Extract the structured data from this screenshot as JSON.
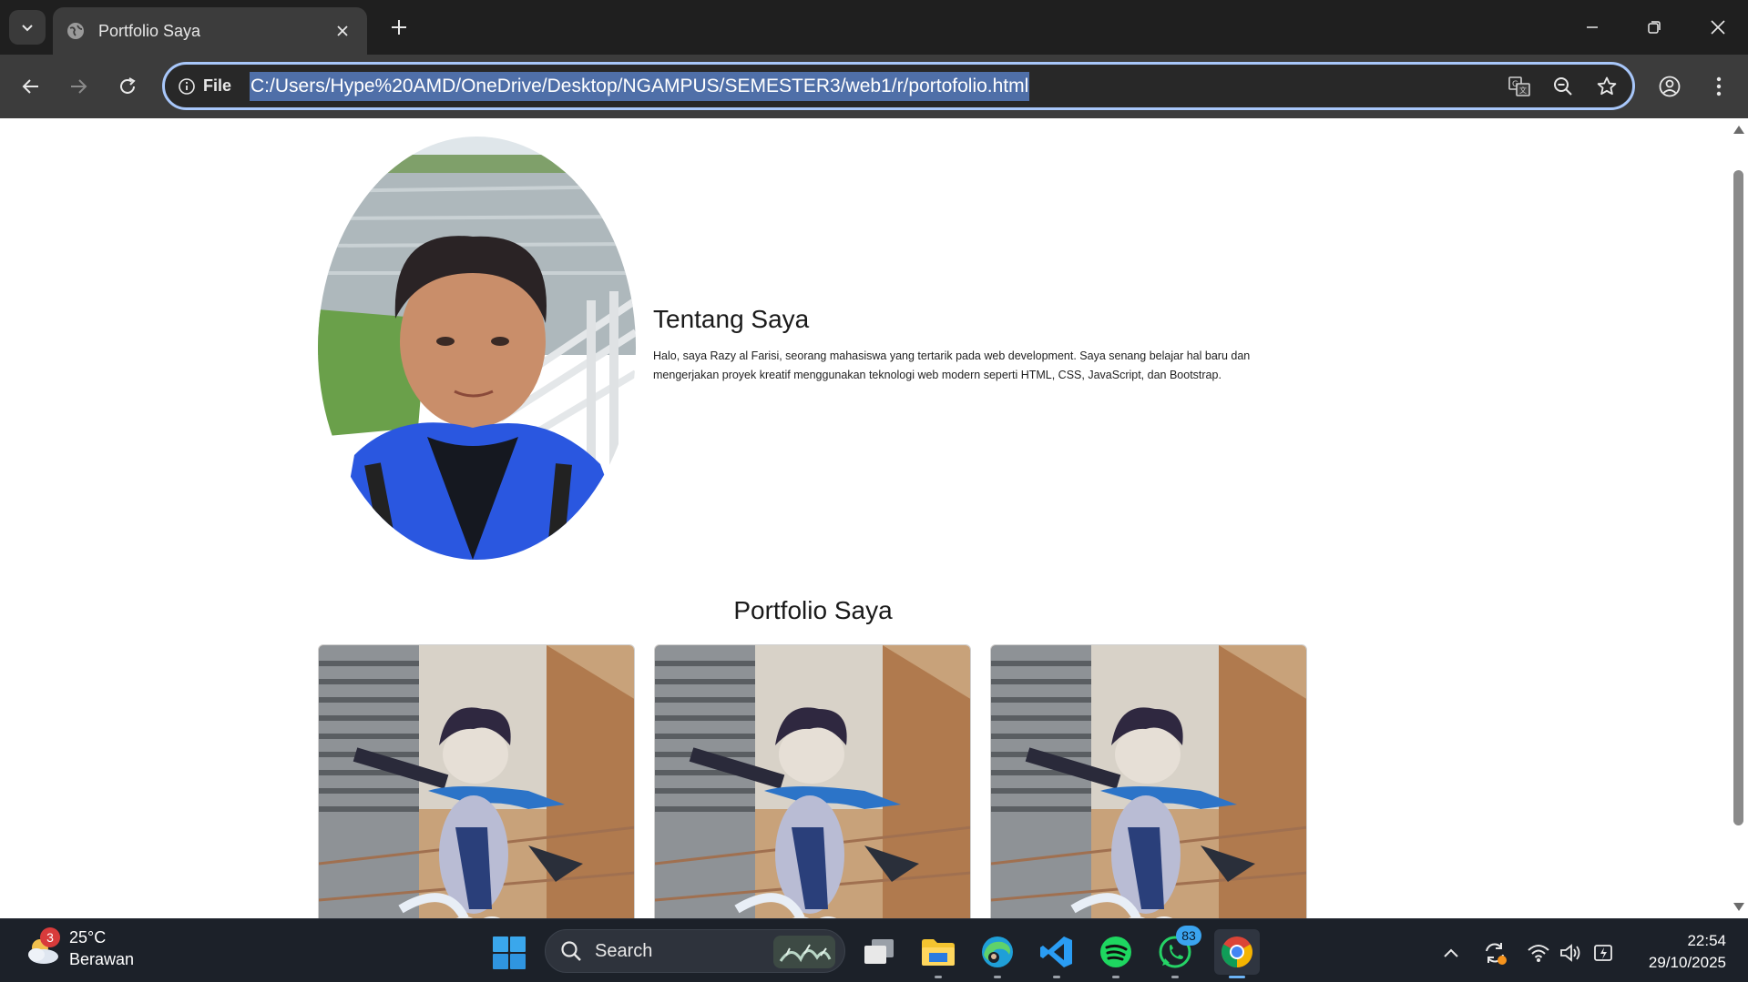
{
  "browser": {
    "tab_title": "Portfolio Saya",
    "omnibox_label": "File",
    "url": "C:/Users/Hype%20AMD/OneDrive/Desktop/NGAMPUS/SEMESTER3/web1/r/portofolio.html"
  },
  "page": {
    "about_title": "Tentang Saya",
    "about_text_line1": "Halo, saya Razy al Farisi, seorang mahasiswa yang tertarik pada web development. Saya senang belajar hal baru dan",
    "about_text_line2": "mengerjakan proyek kreatif menggunakan teknologi web modern seperti HTML, CSS, JavaScript, dan Bootstrap.",
    "portfolio_title": "Portfolio Saya"
  },
  "taskbar": {
    "weather_badge": "3",
    "temperature": "25°C",
    "condition": "Berawan",
    "search_label": "Search",
    "whatsapp_badge": "83",
    "time": "22:54",
    "date": "29/10/2025"
  },
  "colors": {
    "omnibox_focus": "#a8c7fa",
    "url_selection": "#4f6fa8",
    "taskbar_bg": "#1c2129"
  },
  "icons": [
    "tab-search-icon",
    "globe-icon",
    "close-icon",
    "plus-icon",
    "minimize-icon",
    "restore-icon",
    "back-icon",
    "forward-icon",
    "reload-icon",
    "info-icon",
    "translate-icon",
    "zoom-icon",
    "star-icon",
    "profile-icon",
    "menu-icon",
    "windows-icon",
    "search-icon",
    "task-view-icon",
    "file-explorer-icon",
    "edge-icon",
    "vscode-icon",
    "spotify-icon",
    "whatsapp-icon",
    "chrome-icon",
    "chevron-up-icon",
    "sync-icon",
    "wifi-icon",
    "volume-icon",
    "battery-icon"
  ]
}
